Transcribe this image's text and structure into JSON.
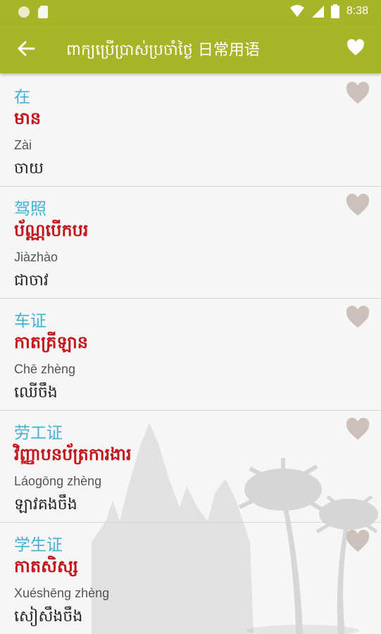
{
  "status_bar": {
    "time": "8:38"
  },
  "toolbar": {
    "title": "ពាក្យប្រើប្រាស់ប្រចាំថ្ងៃ 日常用语"
  },
  "items": [
    {
      "chinese": "在",
      "khmer": "មាន",
      "pinyin": "Zài",
      "khmer_phonetic": "ចាយ"
    },
    {
      "chinese": "驾照",
      "khmer": "ប័ណ្ណបើកបរ",
      "pinyin": "Jiàzhào",
      "khmer_phonetic": "ជាចាវ"
    },
    {
      "chinese": "车证",
      "khmer": "កាតគ្រីឡាន",
      "pinyin": "Chē zhèng",
      "khmer_phonetic": "ឈើចឹង"
    },
    {
      "chinese": "劳工证",
      "khmer": "វិញ្ញាបនប័ត្រការងារ",
      "pinyin": "Láogōng zhèng",
      "khmer_phonetic": "ឡាវគងចឹង"
    },
    {
      "chinese": "学生证",
      "khmer": "កាតសិស្ស",
      "pinyin": "Xuéshēng zhèng",
      "khmer_phonetic": "សៀសឹងចឹង"
    }
  ],
  "colors": {
    "accent": "#a8b428",
    "chinese_text": "#41b1d4",
    "khmer_text": "#c0181c",
    "heart": "#cdbfba"
  }
}
